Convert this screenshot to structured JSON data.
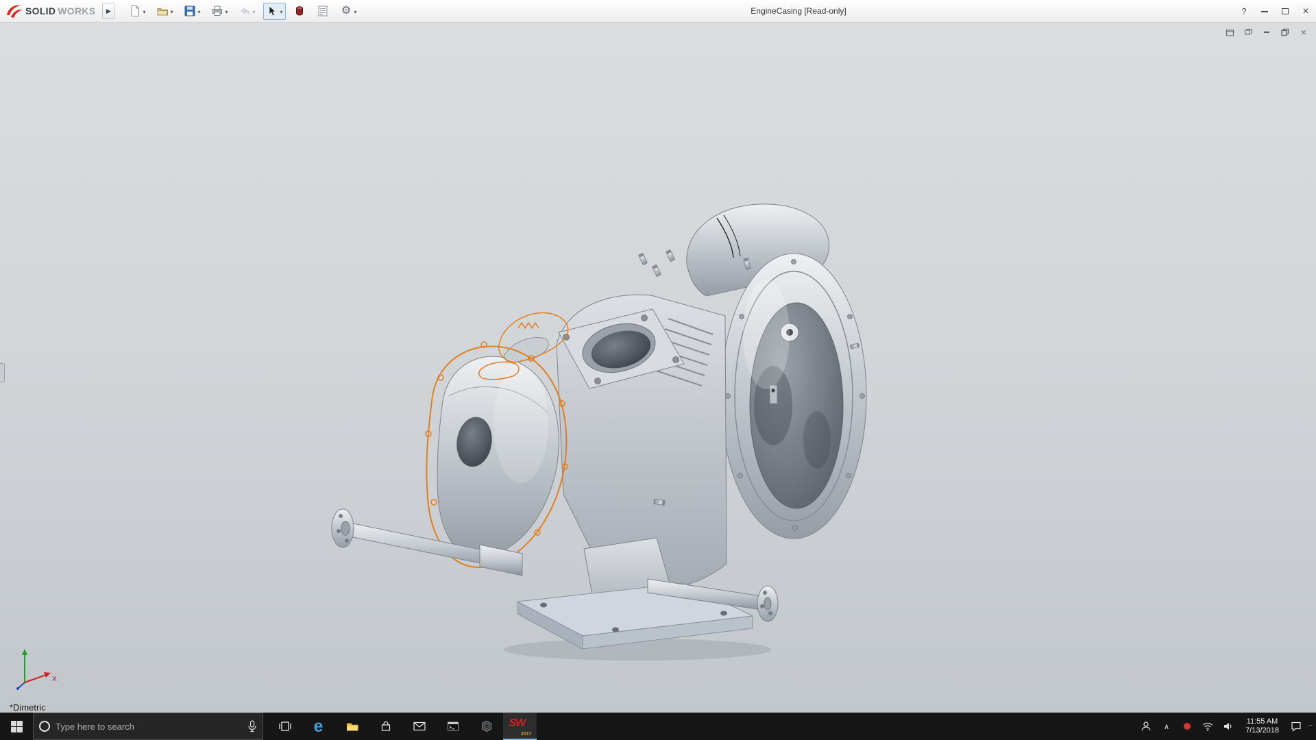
{
  "titlebar": {
    "brand_bold": "SOLID",
    "brand_light": "WORKS",
    "document_title": "EngineCasing [Read-only]",
    "help_label": "?"
  },
  "icons": {
    "expand_arrow": "▶",
    "chevron_down": "▾",
    "gear": "⚙",
    "close": "×",
    "tray_chevron": "∧",
    "edge_letter": "e"
  },
  "toolbar": {
    "buttons": [
      "new-document",
      "open",
      "save",
      "print",
      "undo",
      "select",
      "render-tools",
      "properties",
      "options"
    ]
  },
  "document_window": {
    "controls": [
      "float-pane",
      "restore-pane",
      "minimize",
      "restore",
      "close"
    ]
  },
  "viewport": {
    "view_label": "*Dimetric",
    "triad_x_label": "X"
  },
  "taskbar": {
    "search_placeholder": "Type here to search",
    "apps": [
      "task-view",
      "edge",
      "file-explorer",
      "store",
      "mail",
      "command-prompt",
      "edrawings",
      "solidworks-2017"
    ],
    "solidworks_label": "SW",
    "solidworks_year": "2017",
    "clock": {
      "time": "11:55 AM",
      "date": "7/13/2018"
    }
  },
  "colors": {
    "highlight_orange": "#e07f1f",
    "taskbar_bg": "#161616",
    "titlebar_bg": "#f2f3f4",
    "save_blue": "#3f72b8",
    "sw_red": "#d0222a"
  }
}
